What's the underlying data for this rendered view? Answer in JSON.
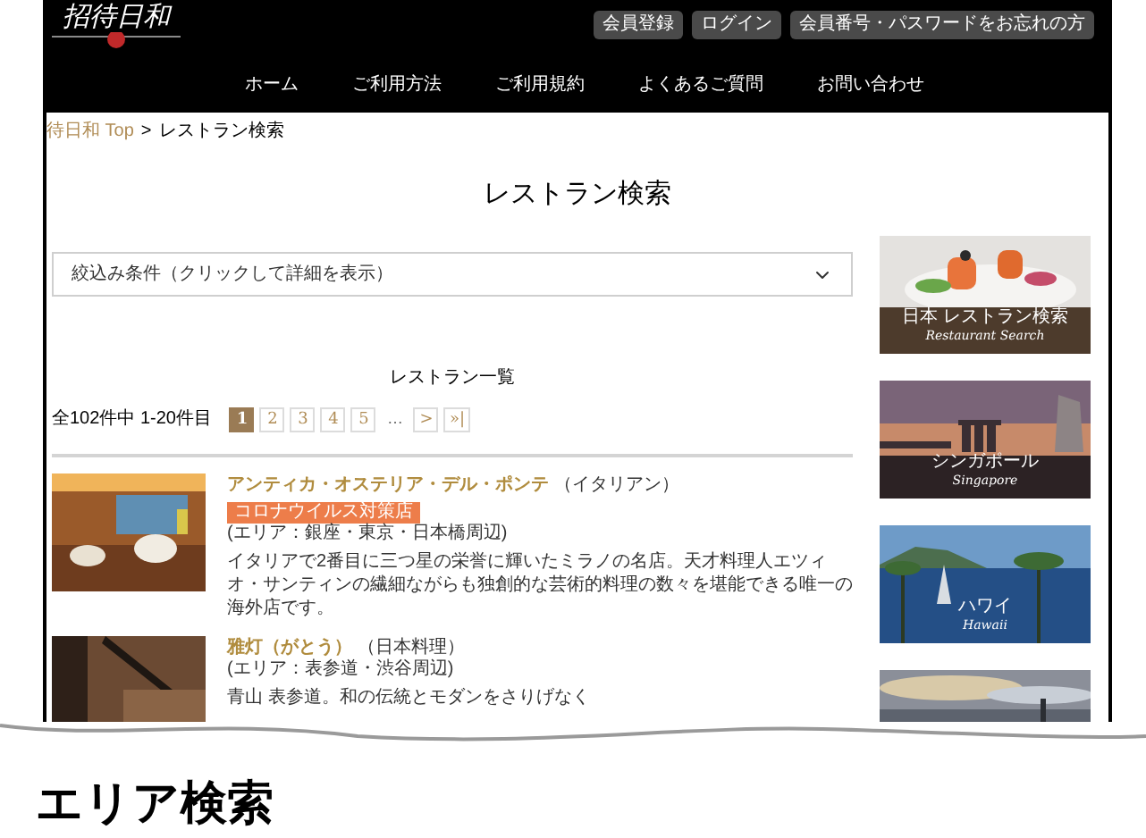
{
  "header": {
    "logo": "招待日和",
    "buttons": [
      "会員登録",
      "ログイン",
      "会員番号・パスワードをお忘れの方"
    ]
  },
  "nav": [
    "ホーム",
    "ご利用方法",
    "ご利用規約",
    "よくあるご質問",
    "お問い合わせ"
  ],
  "breadcrumb": {
    "link": "待日和 Top",
    "separator": ">",
    "current": "レストラン検索"
  },
  "page_title": "レストラン検索",
  "filter": {
    "label": "絞込み条件（クリックして詳細を表示）",
    "expanded": false
  },
  "list_title": "レストラン一覧",
  "result_count": "全102件中 1-20件目",
  "pagination": [
    {
      "label": "1",
      "kind": "page",
      "selected": true
    },
    {
      "label": "2",
      "kind": "page",
      "selected": false
    },
    {
      "label": "3",
      "kind": "page",
      "selected": false
    },
    {
      "label": "4",
      "kind": "page",
      "selected": false
    },
    {
      "label": "5",
      "kind": "page",
      "selected": false
    },
    {
      "label": "…",
      "kind": "ellipsis"
    },
    {
      "label": ">",
      "kind": "page",
      "selected": false
    },
    {
      "label": "»|",
      "kind": "page",
      "selected": false
    }
  ],
  "restaurants": [
    {
      "name": "アンティカ・オステリア・デル・ポンテ",
      "cuisine": "（イタリアン）",
      "badge": "コロナウイルス対策店",
      "area": "(エリア：銀座・東京・日本橋周辺)",
      "description": "イタリアで2番目に三つ星の栄誉に輝いたミラノの名店。天才料理人エツィオ・サンティンの繊細ながらも独創的な芸術的料理の数々を堪能できる唯一の海外店です。",
      "kind": "dining"
    },
    {
      "name": "雅灯（がとう）",
      "cuisine": "（日本料理）",
      "area": "(エリア：表参道・渋谷周辺)",
      "description": "青山 表参道。和の伝統とモダンをさりげなく",
      "kind": "washoku"
    }
  ],
  "banners": [
    {
      "title": "日本 レストラン検索",
      "subtitle": "Restaurant Search",
      "kind": "food"
    },
    {
      "title": "シンガポール",
      "subtitle": "Singapore",
      "kind": "city"
    },
    {
      "title": "ハワイ",
      "subtitle": "Hawaii",
      "kind": "beach"
    },
    {
      "kind": "sky"
    }
  ],
  "section_heading": "エリア検索"
}
